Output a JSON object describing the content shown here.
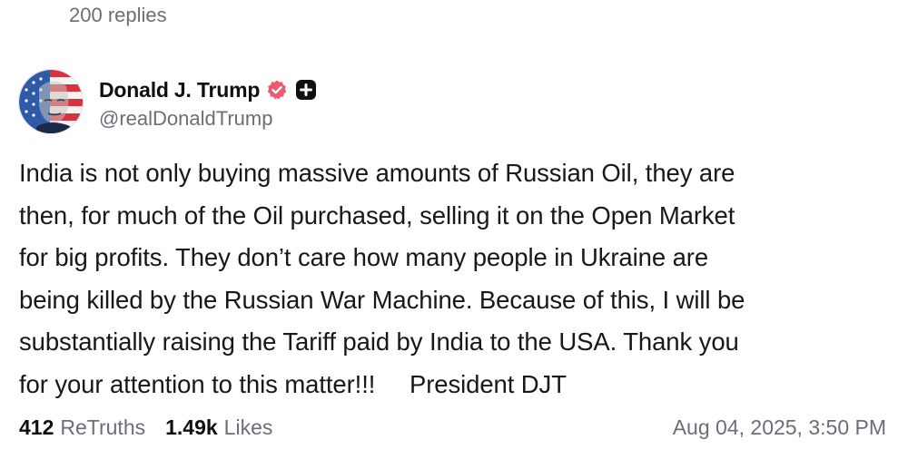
{
  "replies": {
    "label": "200 replies"
  },
  "author": {
    "display_name": "Donald J. Trump",
    "handle": "@realDonaldTrump",
    "verified_icon": "verified-badge-icon",
    "plus_icon": "plus-badge-icon",
    "verified_color": "#ee5a6f"
  },
  "post": {
    "text": "India is not only buying massive amounts of Russian Oil, they are\nthen, for much of the Oil purchased, selling it on the Open Market\nfor big profits. They don’t care how many people in Ukraine are\nbeing killed by the Russian War Machine. Because of this, I will be\nsubstantially raising the Tariff paid by India to the USA. Thank you\nfor your attention to this matter!!!     President DJT"
  },
  "stats": {
    "retruths_count": "412",
    "retruths_label": "ReTruths",
    "likes_count": "1.49k",
    "likes_label": "Likes",
    "timestamp": "Aug 04, 2025, 3:50 PM"
  }
}
